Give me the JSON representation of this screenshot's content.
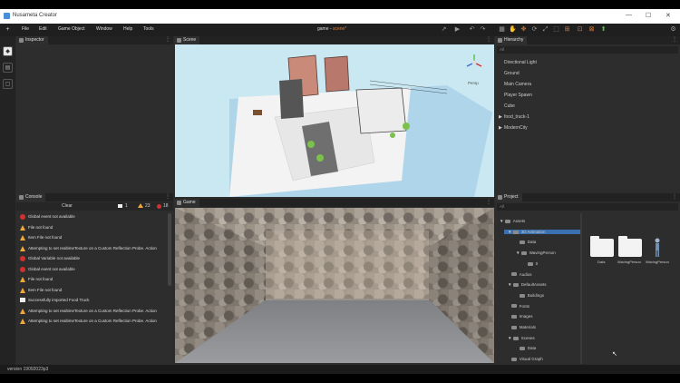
{
  "app": {
    "title": "Nusameta Creator",
    "status_version": "version 19092023p3"
  },
  "window_controls": {
    "minimize": "—",
    "maximize": "☐",
    "close": "✕"
  },
  "menu": {
    "items": [
      "File",
      "Edit",
      "Game Object",
      "Window",
      "Help",
      "Tools"
    ]
  },
  "scene_file": {
    "name": "game - ",
    "state": "scene*"
  },
  "toolbar": {
    "icons": [
      "pointer-icon",
      "play-icon",
      "undo-icon",
      "redo-icon",
      "grid-icon",
      "hand-icon",
      "move-icon",
      "rotate-icon",
      "scale-icon",
      "rect-icon",
      "transform-icon",
      "lock-icon",
      "upload-icon",
      "settings-icon"
    ]
  },
  "inspector": {
    "tab": "Inspector"
  },
  "scene": {
    "tab": "Scene",
    "gizmo_label": "Persp"
  },
  "game": {
    "tab": "Game"
  },
  "console": {
    "tab": "Console",
    "clear_label": "Clear",
    "counts": {
      "info": "1",
      "warning": "23",
      "error": "18"
    },
    "messages": [
      {
        "type": "error",
        "text": "Global event not available"
      },
      {
        "type": "warning",
        "text": "File not found"
      },
      {
        "type": "warning",
        "text": "Item File not found"
      },
      {
        "type": "warning",
        "text": "Attempting to set realtimeTexture on a Custom Reflection Probe. Action"
      },
      {
        "type": "error",
        "text": "Global Variable not available"
      },
      {
        "type": "error",
        "text": "Global event not available"
      },
      {
        "type": "warning",
        "text": "File not found"
      },
      {
        "type": "warning",
        "text": "Item File not found"
      },
      {
        "type": "info",
        "text": "Successfully imported Food Truck"
      },
      {
        "type": "warning",
        "text": "Attempting to set realtimeTexture on a Custom Reflection Probe. Action"
      },
      {
        "type": "warning",
        "text": "Attempting to set realtimeTexture on a Custom Reflection Probe. Action"
      }
    ]
  },
  "hierarchy": {
    "tab": "Hierarchy",
    "search_placeholder": "All",
    "items": [
      "Directional Light",
      "Ground",
      "Main Camera",
      "Player Spawn",
      "Cube",
      "food_truck-1",
      "ModernCity"
    ]
  },
  "project": {
    "tab": "Project",
    "search_placeholder": "All",
    "tree": [
      "Assets",
      "3D Animation",
      "Data",
      "WavingPerson",
      "0",
      "Audios",
      "DefaultAssets",
      "Buildings",
      "Fonts",
      "Images",
      "Materials",
      "Scenes",
      "Data",
      "Visual Graph"
    ],
    "grid": [
      "Data",
      "WavingPerson",
      "WavingPerson"
    ]
  },
  "colors": {
    "accent": "#3a6fb0",
    "error": "#d23030",
    "warning": "#f2a73b",
    "scene_sky": "#c9e8f2"
  }
}
